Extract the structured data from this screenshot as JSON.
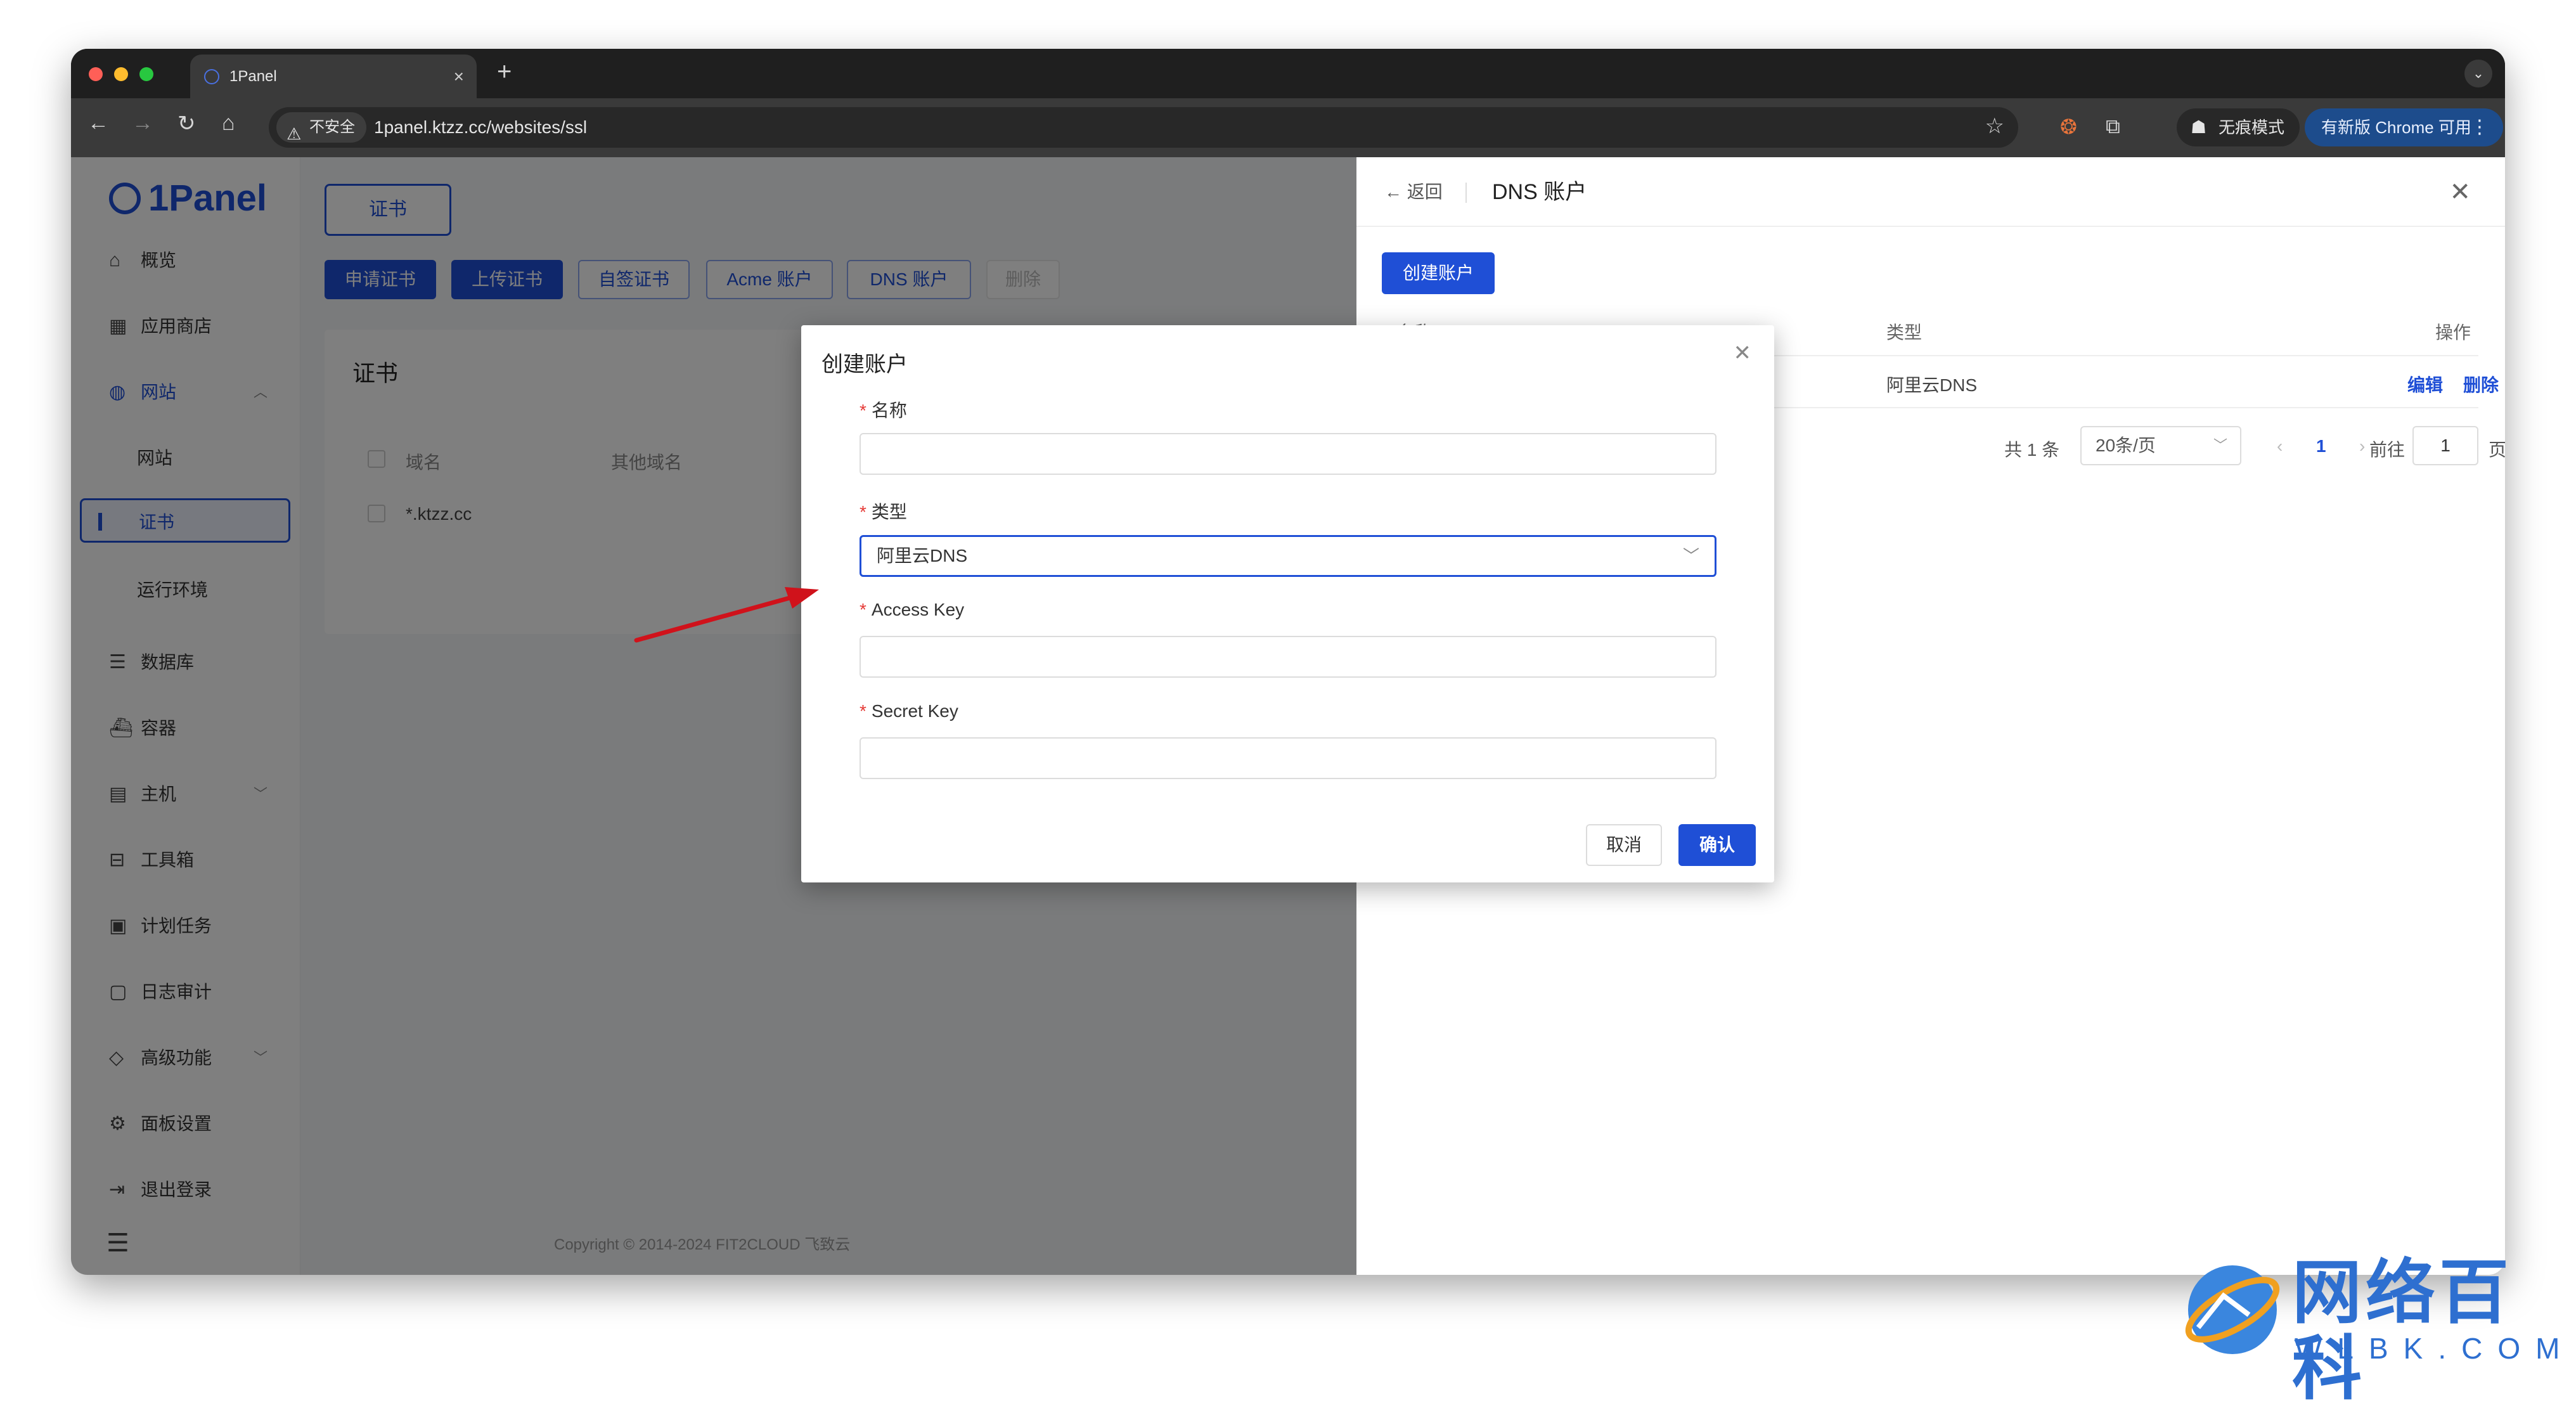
{
  "browser": {
    "tab_title": "1Panel",
    "tab_close": "×",
    "new_tab": "+",
    "tab_menu": "⌄",
    "insecure_label": "不安全",
    "url": "1panel.ktzz.cc/websites/ssl",
    "incognito_label": "无痕模式",
    "update_label": "有新版 Chrome 可用"
  },
  "sidebar": {
    "logo": "1Panel",
    "items": [
      {
        "label": "概览"
      },
      {
        "label": "应用商店"
      },
      {
        "label": "网站"
      },
      {
        "label": "网站"
      },
      {
        "label": "证书"
      },
      {
        "label": "运行环境"
      },
      {
        "label": "数据库"
      },
      {
        "label": "容器"
      },
      {
        "label": "主机"
      },
      {
        "label": "工具箱"
      },
      {
        "label": "计划任务"
      },
      {
        "label": "日志审计"
      },
      {
        "label": "高级功能"
      },
      {
        "label": "面板设置"
      },
      {
        "label": "退出登录"
      }
    ]
  },
  "main": {
    "tab_cert": "证书",
    "buttons": [
      "申请证书",
      "上传证书",
      "自签证书",
      "Acme 账户",
      "DNS 账户",
      "删除"
    ],
    "card_title": "证书",
    "columns": [
      "域名",
      "其他域名"
    ],
    "rows": [
      {
        "domain": "*.ktzz.cc"
      }
    ],
    "copyright": "Copyright © 2014-2024 FIT2CLOUD 飞致云"
  },
  "drawer": {
    "back": "返回",
    "title": "DNS 账户",
    "create_button": "创建账户",
    "columns": {
      "name": "名称",
      "type": "类型",
      "actions": "操作"
    },
    "rows": [
      {
        "type": "阿里云DNS",
        "edit": "编辑",
        "delete": "删除"
      }
    ],
    "pagination": {
      "total": "共 1 条",
      "page_size": "20条/页",
      "current_page": "1",
      "goto_label": "前往",
      "goto_value": "1",
      "page_suffix": "页"
    }
  },
  "modal": {
    "title": "创建账户",
    "fields": {
      "name_label": "名称",
      "type_label": "类型",
      "type_value": "阿里云DNS",
      "access_key_label": "Access Key",
      "secret_key_label": "Secret Key"
    },
    "cancel": "取消",
    "confirm": "确认"
  },
  "watermark": {
    "title": "网络百科",
    "subtitle": "WLBK.COM"
  },
  "colors": {
    "accent": "#1f4fd6",
    "required": "#e53935",
    "annotation_arrow": "#d0121b"
  }
}
